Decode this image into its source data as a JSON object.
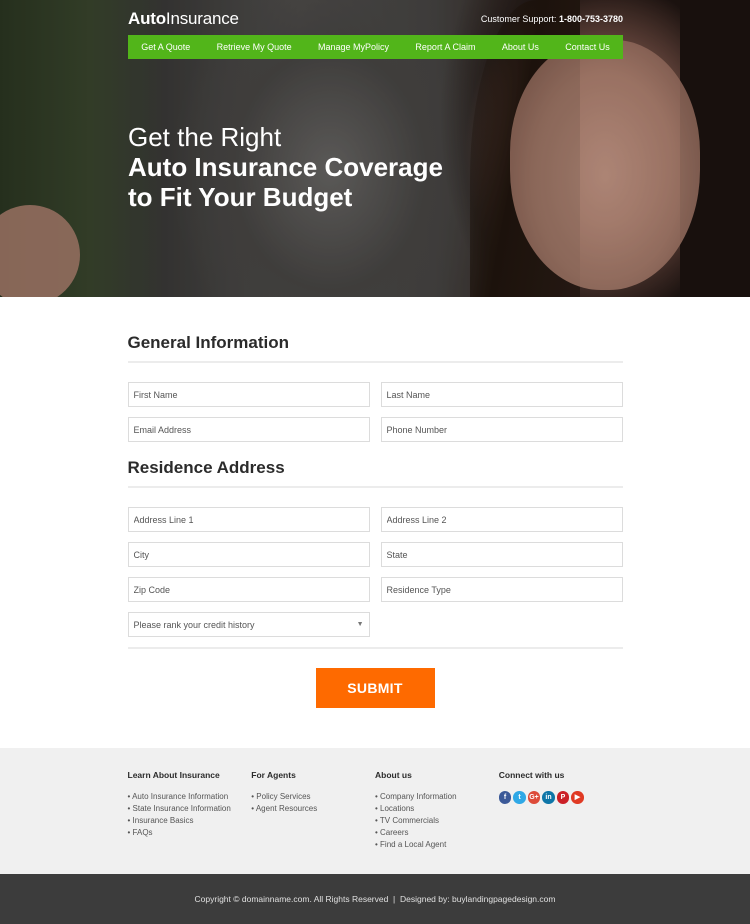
{
  "header": {
    "logo_bold": "Auto",
    "logo_light": "Insurance",
    "support_label": "Customer Support:",
    "support_phone": "1-800-753-3780"
  },
  "nav": {
    "items": [
      {
        "label": "Get A Quote"
      },
      {
        "label": "Retrieve My Quote"
      },
      {
        "label": "Manage MyPolicy"
      },
      {
        "label": "Report A Claim"
      },
      {
        "label": "About Us"
      },
      {
        "label": "Contact Us"
      }
    ]
  },
  "hero": {
    "line1": "Get the Right",
    "line2": "Auto Insurance Coverage",
    "line3": "to Fit Your Budget"
  },
  "form": {
    "general_title": "General Information",
    "general_fields": {
      "first_name": {
        "placeholder": "First Name",
        "value": ""
      },
      "last_name": {
        "placeholder": "Last Name",
        "value": ""
      },
      "email": {
        "placeholder": "Email Address",
        "value": ""
      },
      "phone": {
        "placeholder": "Phone Number",
        "value": ""
      }
    },
    "residence_title": "Residence Address",
    "residence_fields": {
      "address1": {
        "placeholder": "Address Line 1",
        "value": ""
      },
      "address2": {
        "placeholder": "Address Line 2",
        "value": ""
      },
      "city": {
        "placeholder": "City",
        "value": ""
      },
      "state": {
        "placeholder": "State",
        "value": ""
      },
      "zip": {
        "placeholder": "Zip Code",
        "value": ""
      },
      "residence_type": {
        "placeholder": "Residence Type",
        "value": ""
      }
    },
    "credit_select": {
      "selected": "Please rank your credit history"
    },
    "submit_label": "SUBMIT"
  },
  "colors": {
    "nav_green": "#52b51a",
    "submit_orange": "#fe6a00",
    "footer_bg": "#f0f0f0",
    "copyright_bg": "#3c3c3c"
  },
  "footer": {
    "columns": [
      {
        "title": "Learn About Insurance",
        "links": [
          "Auto Insurance Information",
          "State Insurance Information",
          "Insurance Basics",
          "FAQs"
        ]
      },
      {
        "title": "For Agents",
        "links": [
          "Policy Services",
          "Agent Resources"
        ]
      },
      {
        "title": "About us",
        "links": [
          "Company Information",
          "Locations",
          "TV Commercials",
          "Careers",
          "Find a Local Agent"
        ]
      }
    ],
    "social_title": "Connect with us",
    "social": [
      {
        "name": "facebook-icon",
        "glyph": "f",
        "color": "#3b5998"
      },
      {
        "name": "twitter-icon",
        "glyph": "t",
        "color": "#2fa8e6"
      },
      {
        "name": "google-plus-icon",
        "glyph": "G+",
        "color": "#dd4b39"
      },
      {
        "name": "linkedin-icon",
        "glyph": "in",
        "color": "#0e76a8"
      },
      {
        "name": "pinterest-icon",
        "glyph": "P",
        "color": "#cb2027"
      },
      {
        "name": "youtube-icon",
        "glyph": "▶",
        "color": "#e03a24"
      }
    ],
    "copyright": "Copyright © domainname.com. All Rights Reserved  |  Designed by: buylandingpagedesign.com"
  }
}
